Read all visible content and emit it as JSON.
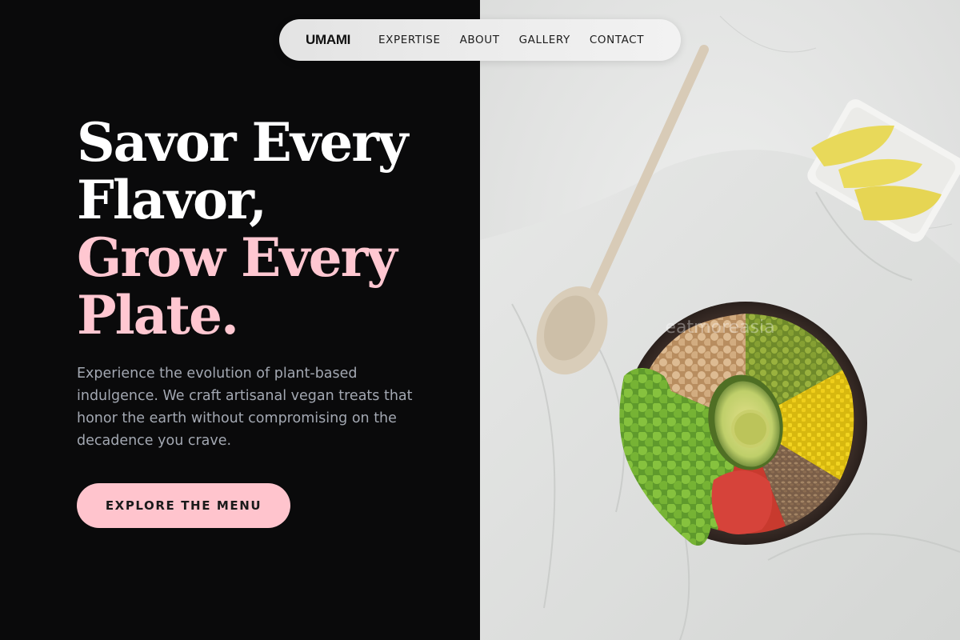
{
  "nav": {
    "brand": "UMAMI",
    "links": [
      "EXPERTISE",
      "ABOUT",
      "GALLERY",
      "CONTACT"
    ]
  },
  "hero": {
    "headline_lines": [
      "Savor Every",
      "Flavor,",
      "Grow Every",
      "Plate."
    ],
    "description": "Experience the evolution of plant-based indulgence. We craft artisanal vegan treats that honor the earth without compromising on the decadence you crave.",
    "cta_label": "EXPLORE THE MENU"
  },
  "image": {
    "subject": "buddha-bowl-photo",
    "watermark": "eatmoreasia"
  },
  "colors": {
    "background": "#0a0a0b",
    "accent_pink": "#ffc4cd",
    "headline_white": "#ffffff",
    "body_text": "#a3a8b2",
    "nav_bg": "#ececec"
  }
}
